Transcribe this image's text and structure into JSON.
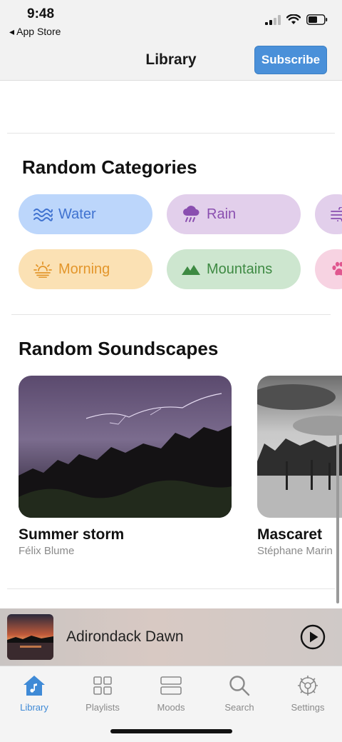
{
  "status": {
    "time": "9:48",
    "back_label": "◂ App Store"
  },
  "nav": {
    "title": "Library",
    "subscribe_label": "Subscribe"
  },
  "categories": {
    "title": "Random Categories",
    "items": [
      {
        "label": "Water",
        "icon": "water-waves-icon",
        "bg": "#bcd6fb",
        "fg": "#3f72d0"
      },
      {
        "label": "Rain",
        "icon": "rain-cloud-icon",
        "bg": "#e2cfeb",
        "fg": "#8a4fb0"
      },
      {
        "label": "",
        "icon": "wind-icon",
        "bg": "#e2cfeb",
        "fg": "#8a4fb0"
      },
      {
        "label": "Morning",
        "icon": "sunrise-icon",
        "bg": "#fbe1b4",
        "fg": "#e3962b"
      },
      {
        "label": "Mountains",
        "icon": "mountains-icon",
        "bg": "#cde6cf",
        "fg": "#3e8a43"
      },
      {
        "label": "",
        "icon": "paw-icon",
        "bg": "#f7d3e2",
        "fg": "#e0578f"
      }
    ]
  },
  "soundscapes": {
    "title": "Random Soundscapes",
    "items": [
      {
        "title": "Summer storm",
        "author": "Félix Blume"
      },
      {
        "title": "Mascaret",
        "author": "Stéphane Marin"
      }
    ]
  },
  "now_playing": {
    "title": "Adirondack Dawn"
  },
  "tabs": [
    {
      "label": "Library",
      "icon": "library-house-icon",
      "active": true
    },
    {
      "label": "Playlists",
      "icon": "playlists-grid-icon",
      "active": false
    },
    {
      "label": "Moods",
      "icon": "moods-stack-icon",
      "active": false
    },
    {
      "label": "Search",
      "icon": "search-icon",
      "active": false
    },
    {
      "label": "Settings",
      "icon": "settings-gear-icon",
      "active": false
    }
  ],
  "colors": {
    "accent": "#3f8ad6",
    "subscribe_bg": "#4a90d9"
  }
}
